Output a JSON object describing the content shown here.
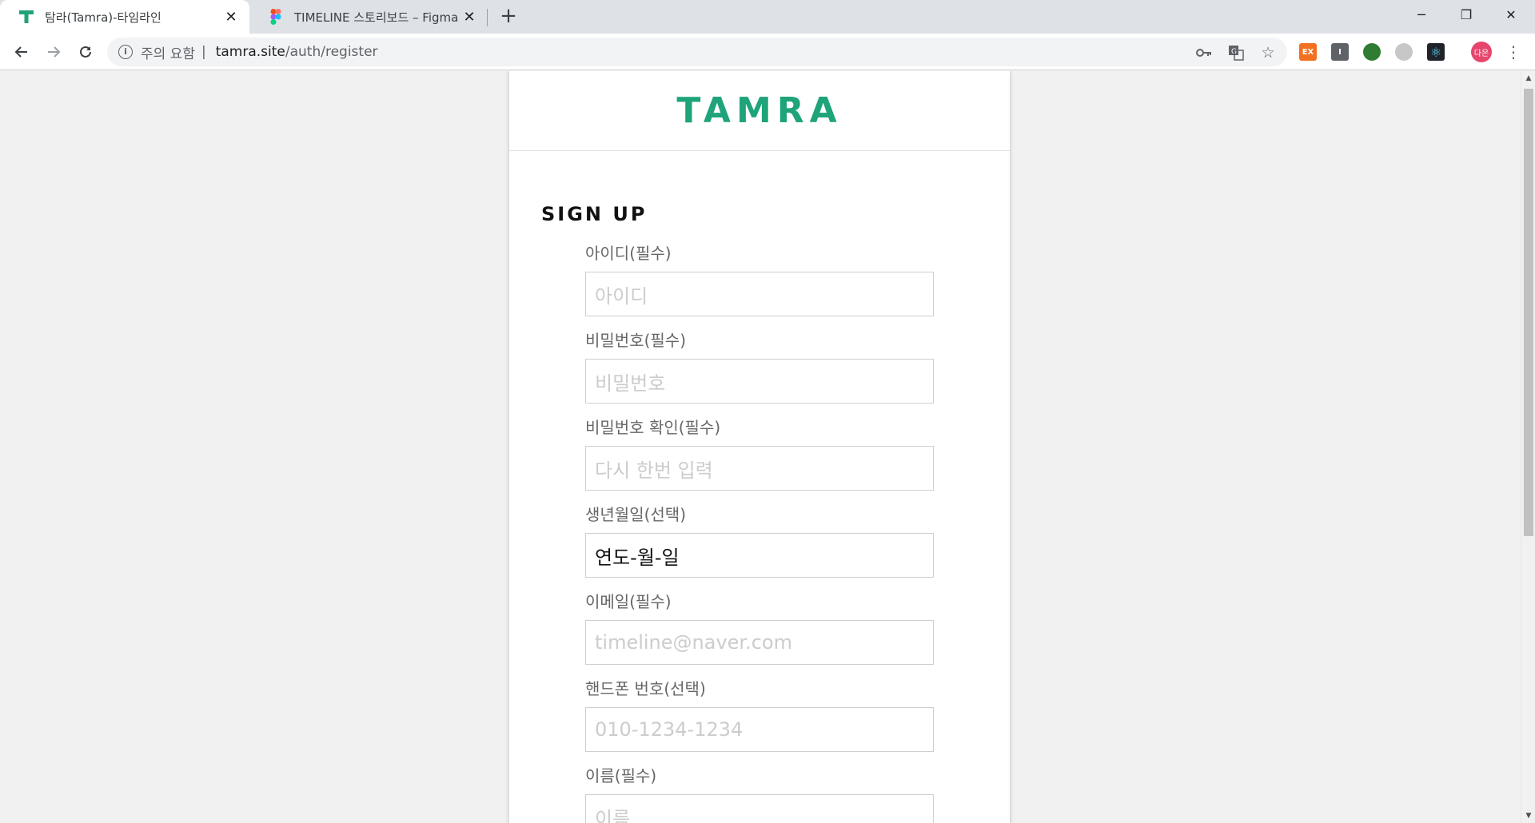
{
  "browser": {
    "tabs": [
      {
        "title": "탐라(Tamra)-타임라인",
        "favicon": "tamra-t-icon",
        "active": true
      },
      {
        "title": "TIMELINE 스토리보드 – Figma",
        "favicon": "figma-icon",
        "active": false
      }
    ],
    "close_glyph": "✕",
    "new_tab_glyph": "+",
    "window_controls": {
      "minimize": "─",
      "restore": "❐",
      "close": "✕"
    },
    "address_bar": {
      "security_label": "주의 요함",
      "separator": "|",
      "host": "tamra.site",
      "path": "/auth/register"
    },
    "profile_initials": "다은",
    "extensions": [
      {
        "name": "ex-extension-icon",
        "label": "EX",
        "color": "#f37021"
      },
      {
        "name": "i-extension-icon",
        "label": "I",
        "color": "#5f6368"
      },
      {
        "name": "leaf-extension-icon",
        "label": "",
        "color": "#2e7d32"
      },
      {
        "name": "circle-extension-icon",
        "label": "",
        "color": "#c7c7c7"
      },
      {
        "name": "react-devtools-icon",
        "label": "⚛",
        "color": "#20232a"
      }
    ]
  },
  "page": {
    "brand": "TAMRA",
    "heading": "SIGN UP",
    "fields": [
      {
        "label": "아이디(필수)",
        "placeholder": "아이디"
      },
      {
        "label": "비밀번호(필수)",
        "placeholder": "비밀번호"
      },
      {
        "label": "비밀번호 확인(필수)",
        "placeholder": "다시 한번 입력"
      },
      {
        "label": "생년월일(선택)",
        "value": "연도-월-일"
      },
      {
        "label": "이메일(필수)",
        "placeholder": "timeline@naver.com"
      },
      {
        "label": "핸드폰 번호(선택)",
        "placeholder": "010-1234-1234"
      },
      {
        "label": "이름(필수)",
        "placeholder": "이름"
      }
    ]
  },
  "colors": {
    "brand": "#1fa37a",
    "tab_strip": "#dee1e6",
    "page_background": "#f1f1f1"
  }
}
